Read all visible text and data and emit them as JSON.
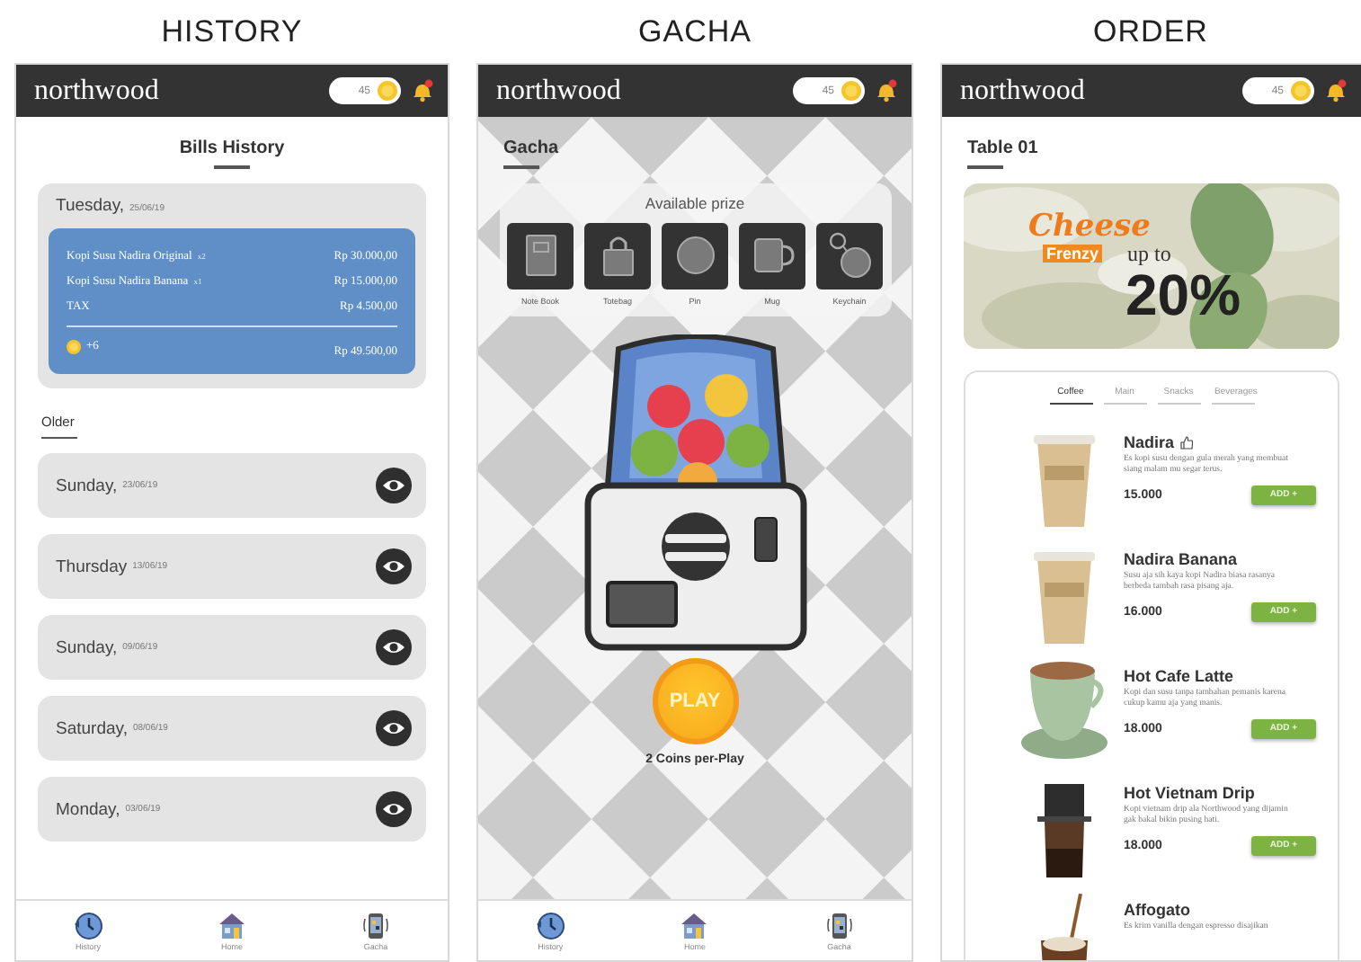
{
  "screens": [
    {
      "kind": "history",
      "caption": "HISTORY",
      "header": {
        "brand": "northwood",
        "coins": "45"
      },
      "title": "Bills History",
      "latest": {
        "day": "Tuesday,",
        "date": "25/06/19",
        "items": [
          {
            "name": "Kopi Susu Nadira Original",
            "qty": "x2",
            "price": "Rp 30.000,00"
          },
          {
            "name": "Kopi Susu Nadira Banana",
            "qty": "x1",
            "price": "Rp 15.000,00"
          },
          {
            "name": "TAX",
            "price": "Rp 4.500,00"
          }
        ],
        "coins_earned": "+6",
        "total": "Rp 49.500,00"
      },
      "older_label": "Older",
      "older": [
        {
          "day": "Sunday,",
          "date": "23/06/19"
        },
        {
          "day": "Thursday",
          "date": "13/06/19"
        },
        {
          "day": "Sunday,",
          "date": "09/06/19"
        },
        {
          "day": "Saturday,",
          "date": "08/06/19"
        },
        {
          "day": "Monday,",
          "date": "03/06/19"
        }
      ],
      "nav": [
        {
          "label": "History",
          "kind": "clock"
        },
        {
          "label": "Home",
          "kind": "house"
        },
        {
          "label": "Gacha",
          "kind": "gacha"
        }
      ]
    },
    {
      "kind": "gacha",
      "caption": "GACHA",
      "header": {
        "brand": "northwood",
        "coins": "45"
      },
      "title": "Gacha",
      "prize_title": "Available prize",
      "prizes": [
        {
          "label": "Note Book",
          "kind": "notebook"
        },
        {
          "label": "Totebag",
          "kind": "bag"
        },
        {
          "label": "Pin",
          "kind": "pin"
        },
        {
          "label": "Mug",
          "kind": "mug"
        },
        {
          "label": "Keychain",
          "kind": "keychain"
        }
      ],
      "play": "PLAY",
      "cost": "2 Coins per-Play",
      "nav": [
        {
          "label": "History",
          "kind": "clock"
        },
        {
          "label": "Home",
          "kind": "house"
        },
        {
          "label": "Gacha",
          "kind": "gacha"
        }
      ]
    },
    {
      "kind": "order",
      "caption": "ORDER",
      "header": {
        "brand": "northwood",
        "coins": "45"
      },
      "title": "Table 01",
      "banner": {
        "script": "Cheese",
        "word": "Frenzy",
        "lead": "up to",
        "value": "20%"
      },
      "tabs": [
        {
          "label": "Coffee",
          "selected": true
        },
        {
          "label": "Main",
          "selected": false
        },
        {
          "label": "Snacks",
          "selected": false
        },
        {
          "label": "Beverages",
          "selected": false
        }
      ],
      "menu": [
        {
          "name": "Nadira",
          "favorite": true,
          "kind": "iced",
          "description": "Es kopi susu dengan gula merah yang membuat siang malam mu segar terus.",
          "price": "15.000",
          "action": "ADD +"
        },
        {
          "name": "Nadira Banana",
          "favorite": false,
          "kind": "iced",
          "description": "Susu aja sih kaya kopi Nadira biasa rasanya berbeda tambah rasa pisang aja.",
          "price": "16.000",
          "action": "ADD +"
        },
        {
          "name": "Hot Cafe Latte",
          "favorite": false,
          "kind": "latte",
          "description": "Kopi dan susu tanpa tambahan pemanis karena cukup kamu aja yang manis.",
          "price": "18.000",
          "action": "ADD +"
        },
        {
          "name": "Hot Vietnam Drip",
          "favorite": false,
          "kind": "drip",
          "description": "Kopi vietnam drip ala Northwood yang dijamin gak bakal bikin pusing hati.",
          "price": "18.000",
          "action": "ADD +"
        },
        {
          "name": "Affogato",
          "favorite": false,
          "kind": "affogato",
          "description": "Es krim vanilla dengan espresso disajikan"
        }
      ]
    }
  ]
}
